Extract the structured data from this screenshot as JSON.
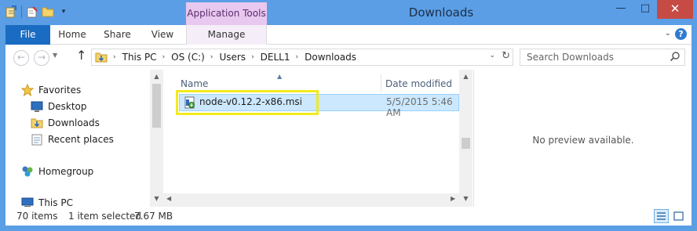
{
  "window": {
    "title": "Downloads",
    "context_tab": "Application Tools",
    "controls": {
      "minimize": "—",
      "maximize": "□",
      "close": "✕"
    }
  },
  "ribbon": {
    "file": "File",
    "tabs": [
      "Home",
      "Share",
      "View"
    ],
    "manage": "Manage",
    "help": "?"
  },
  "navigation": {
    "back": "←",
    "forward": "→",
    "up": "↑",
    "breadcrumb": [
      "This PC",
      "OS (C:)",
      "Users",
      "DELL1",
      "Downloads"
    ],
    "search_placeholder": "Search Downloads"
  },
  "nav_pane": {
    "favorites": "Favorites",
    "items": [
      "Desktop",
      "Downloads",
      "Recent places"
    ],
    "homegroup": "Homegroup",
    "this_pc": "This PC"
  },
  "file_list": {
    "columns": [
      "Name",
      "Date modified"
    ],
    "files": [
      {
        "name": "node-v0.12.2-x86.msi",
        "date": "5/5/2015 5:46 AM",
        "selected": true
      }
    ]
  },
  "preview": {
    "text": "No preview available."
  },
  "status": {
    "item_count": "70 items",
    "selected": "1 item selected",
    "size": "7.67 MB"
  },
  "colors": {
    "frame": "#5a9ee4",
    "file_tab": "#1a6bc2",
    "context_tab": "#e8c8ef",
    "selection": "#cce8ff",
    "highlight": "#f2ea1d",
    "close": "#c74b45"
  }
}
